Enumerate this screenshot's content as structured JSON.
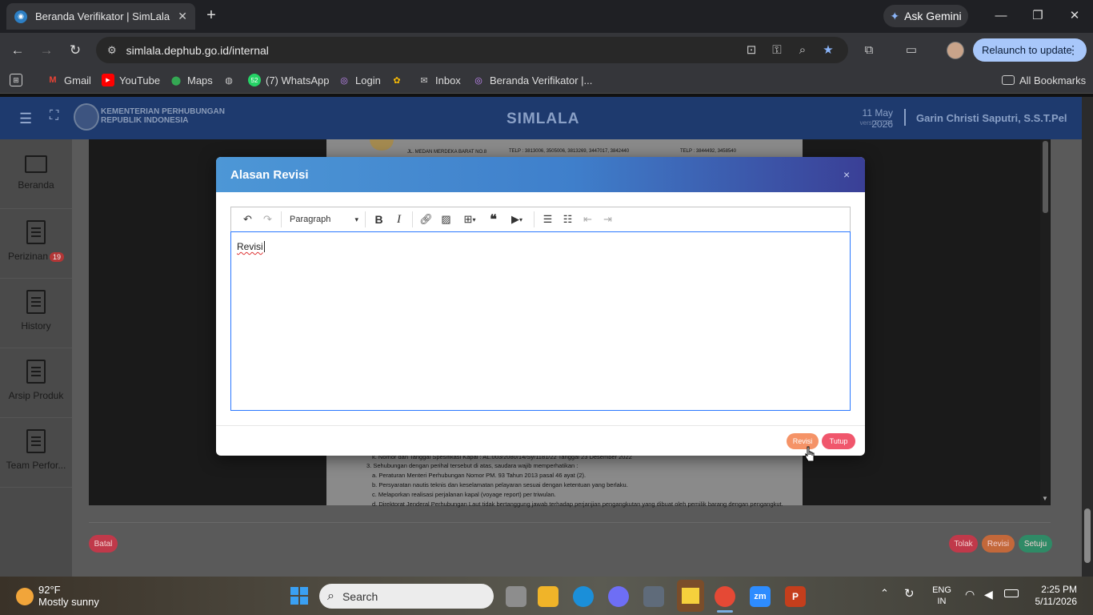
{
  "browser": {
    "tab_title": "Beranda Verifikator | SimLala",
    "url": "simlala.dephub.go.id/internal",
    "gemini_label": "Ask Gemini",
    "relaunch_label": "Relaunch to update",
    "bookmarks": [
      {
        "label": "Gmail",
        "icon": "gmail-icon"
      },
      {
        "label": "YouTube",
        "icon": "youtube-icon"
      },
      {
        "label": "Maps",
        "icon": "maps-icon"
      },
      {
        "label": "",
        "icon": "globe-icon"
      },
      {
        "label": "(7) WhatsApp",
        "icon": "whatsapp-icon",
        "badge": "52"
      },
      {
        "label": "Login",
        "icon": "login-icon"
      },
      {
        "label": "",
        "icon": "photos-icon"
      },
      {
        "label": "Inbox",
        "icon": "mail-icon"
      },
      {
        "label": "Beranda Verifikator |...",
        "icon": "simlala-icon"
      }
    ],
    "all_bookmarks": "All Bookmarks"
  },
  "app": {
    "ministry_line1": "KEMENTERIAN PERHUBUNGAN",
    "ministry_line2": "REPUBLIK INDONESIA",
    "brand": "SIMLALA",
    "date": "11 May 2026",
    "version": "versi 2.0.24",
    "user": "Garin Christi Saputri, S.S.T.Pel"
  },
  "sidebar": {
    "items": [
      {
        "label": "Beranda"
      },
      {
        "label": "Perizinan",
        "badge": "19"
      },
      {
        "label": "History"
      },
      {
        "label": "Arsip Produk"
      },
      {
        "label": "Team Perfor..."
      }
    ]
  },
  "document": {
    "header_addr": "JL. MEDAN MERDEKA BARAT NO.8",
    "header_telp1": "TELP : 3813006, 3505006, 3813269, 3447017, 3842440",
    "header_telp2": "TELP : 3844492, 3458540",
    "lines": [
      "k. Nomor dan Tanggal Spesifikasi Kapal               : AL.003/2080/14/Sy/1181/22  Tanggal 23 Desember 2022",
      "3. Sehubungan dengan perihal tersebut di atas, saudara wajib memperhatikan :",
      "a. Peraturan Menteri Perhubungan Nomor PM. 93 Tahun 2013 pasal 46 ayat (2).",
      "b. Persyaratan nautis teknis dan keselamatan pelayaran sesuai dengan ketentuan yang berlaku.",
      "c. Melaporkan realisasi perjalanan kapal (voyage report) per triwulan.",
      "d. Direktorat Jenderal Perhubungan Laut tidak bertanggung jawab terhadap perjanjian pengangkutan yang dibuat oleh pemilik barang dengan pengangkut."
    ]
  },
  "bottom_buttons": {
    "batal": "Batal",
    "tolak": "Tolak",
    "revisi": "Revisi",
    "setuju": "Setuju"
  },
  "modal": {
    "title": "Alasan Revisi",
    "close": "×",
    "paragraph_select": "Paragraph",
    "editor_text": "Revisi",
    "revisi_button": "Revisi",
    "tutup_button": "Tutup"
  },
  "taskbar": {
    "temperature": "92°F",
    "weather": "Mostly sunny",
    "search_placeholder": "Search",
    "lang1": "ENG",
    "lang2": "IN",
    "time": "2:25 PM",
    "date": "5/11/2026"
  },
  "colors": {
    "header_bg": "#1e3a6e",
    "modal_gradient_start": "#4d97d6",
    "modal_gradient_end": "#3a3f96",
    "revisi": "#f59367",
    "tutup": "#f0566c",
    "tolak": "#d23a4d",
    "setuju": "#3aa57a"
  }
}
